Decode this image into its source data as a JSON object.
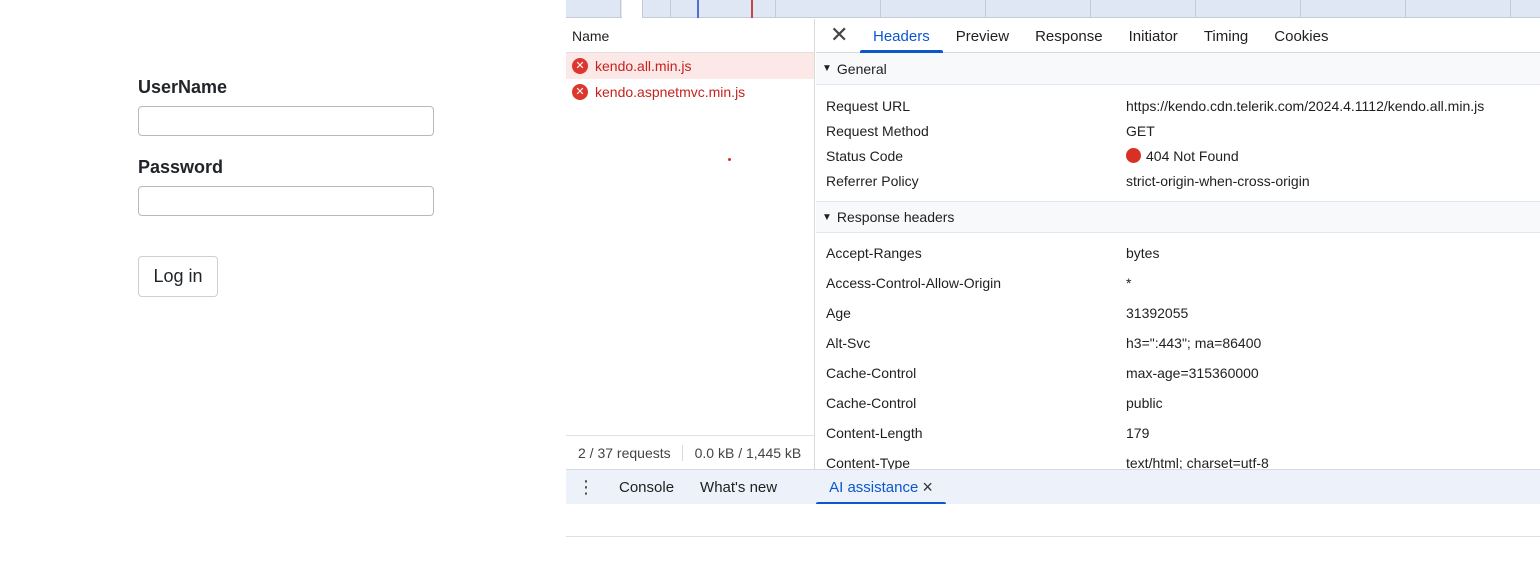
{
  "login": {
    "username_label": "UserName",
    "username_value": "",
    "password_label": "Password",
    "password_value": "",
    "login_button": "Log in"
  },
  "network": {
    "list_header": "Name",
    "requests": [
      {
        "name": "kendo.all.min.js",
        "status": "error",
        "selected": true
      },
      {
        "name": "kendo.aspnetmvc.min.js",
        "status": "error",
        "selected": false
      }
    ],
    "summary_requests": "2 / 37 requests",
    "summary_transferred": "0.0 kB / 1,445 kB"
  },
  "detail": {
    "close_symbol": "✕",
    "tabs": [
      "Headers",
      "Preview",
      "Response",
      "Initiator",
      "Timing",
      "Cookies"
    ],
    "active_tab": "Headers",
    "general_title": "General",
    "general": [
      {
        "key": "Request URL",
        "value": "https://kendo.cdn.telerik.com/2024.4.1112/kendo.all.min.js"
      },
      {
        "key": "Request Method",
        "value": "GET"
      },
      {
        "key": "Status Code",
        "value": "404 Not Found"
      },
      {
        "key": "Referrer Policy",
        "value": "strict-origin-when-cross-origin"
      }
    ],
    "response_headers_title": "Response headers",
    "response_headers": [
      {
        "key": "Accept-Ranges",
        "value": "bytes"
      },
      {
        "key": "Access-Control-Allow-Origin",
        "value": "*"
      },
      {
        "key": "Age",
        "value": "31392055"
      },
      {
        "key": "Alt-Svc",
        "value": "h3=\":443\"; ma=86400"
      },
      {
        "key": "Cache-Control",
        "value": "max-age=315360000"
      },
      {
        "key": "Cache-Control",
        "value": "public"
      },
      {
        "key": "Content-Length",
        "value": "179"
      },
      {
        "key": "Content-Type",
        "value": "text/html; charset=utf-8"
      }
    ]
  },
  "drawer": {
    "menu_symbol": "⋮",
    "tabs": [
      "Console",
      "What's new",
      "AI assistance"
    ],
    "active_tab": "AI assistance",
    "close_symbol": "×"
  },
  "colors": {
    "accent": "#0b57d0",
    "error": "#d93025",
    "selected_row": "#fce8e6"
  }
}
